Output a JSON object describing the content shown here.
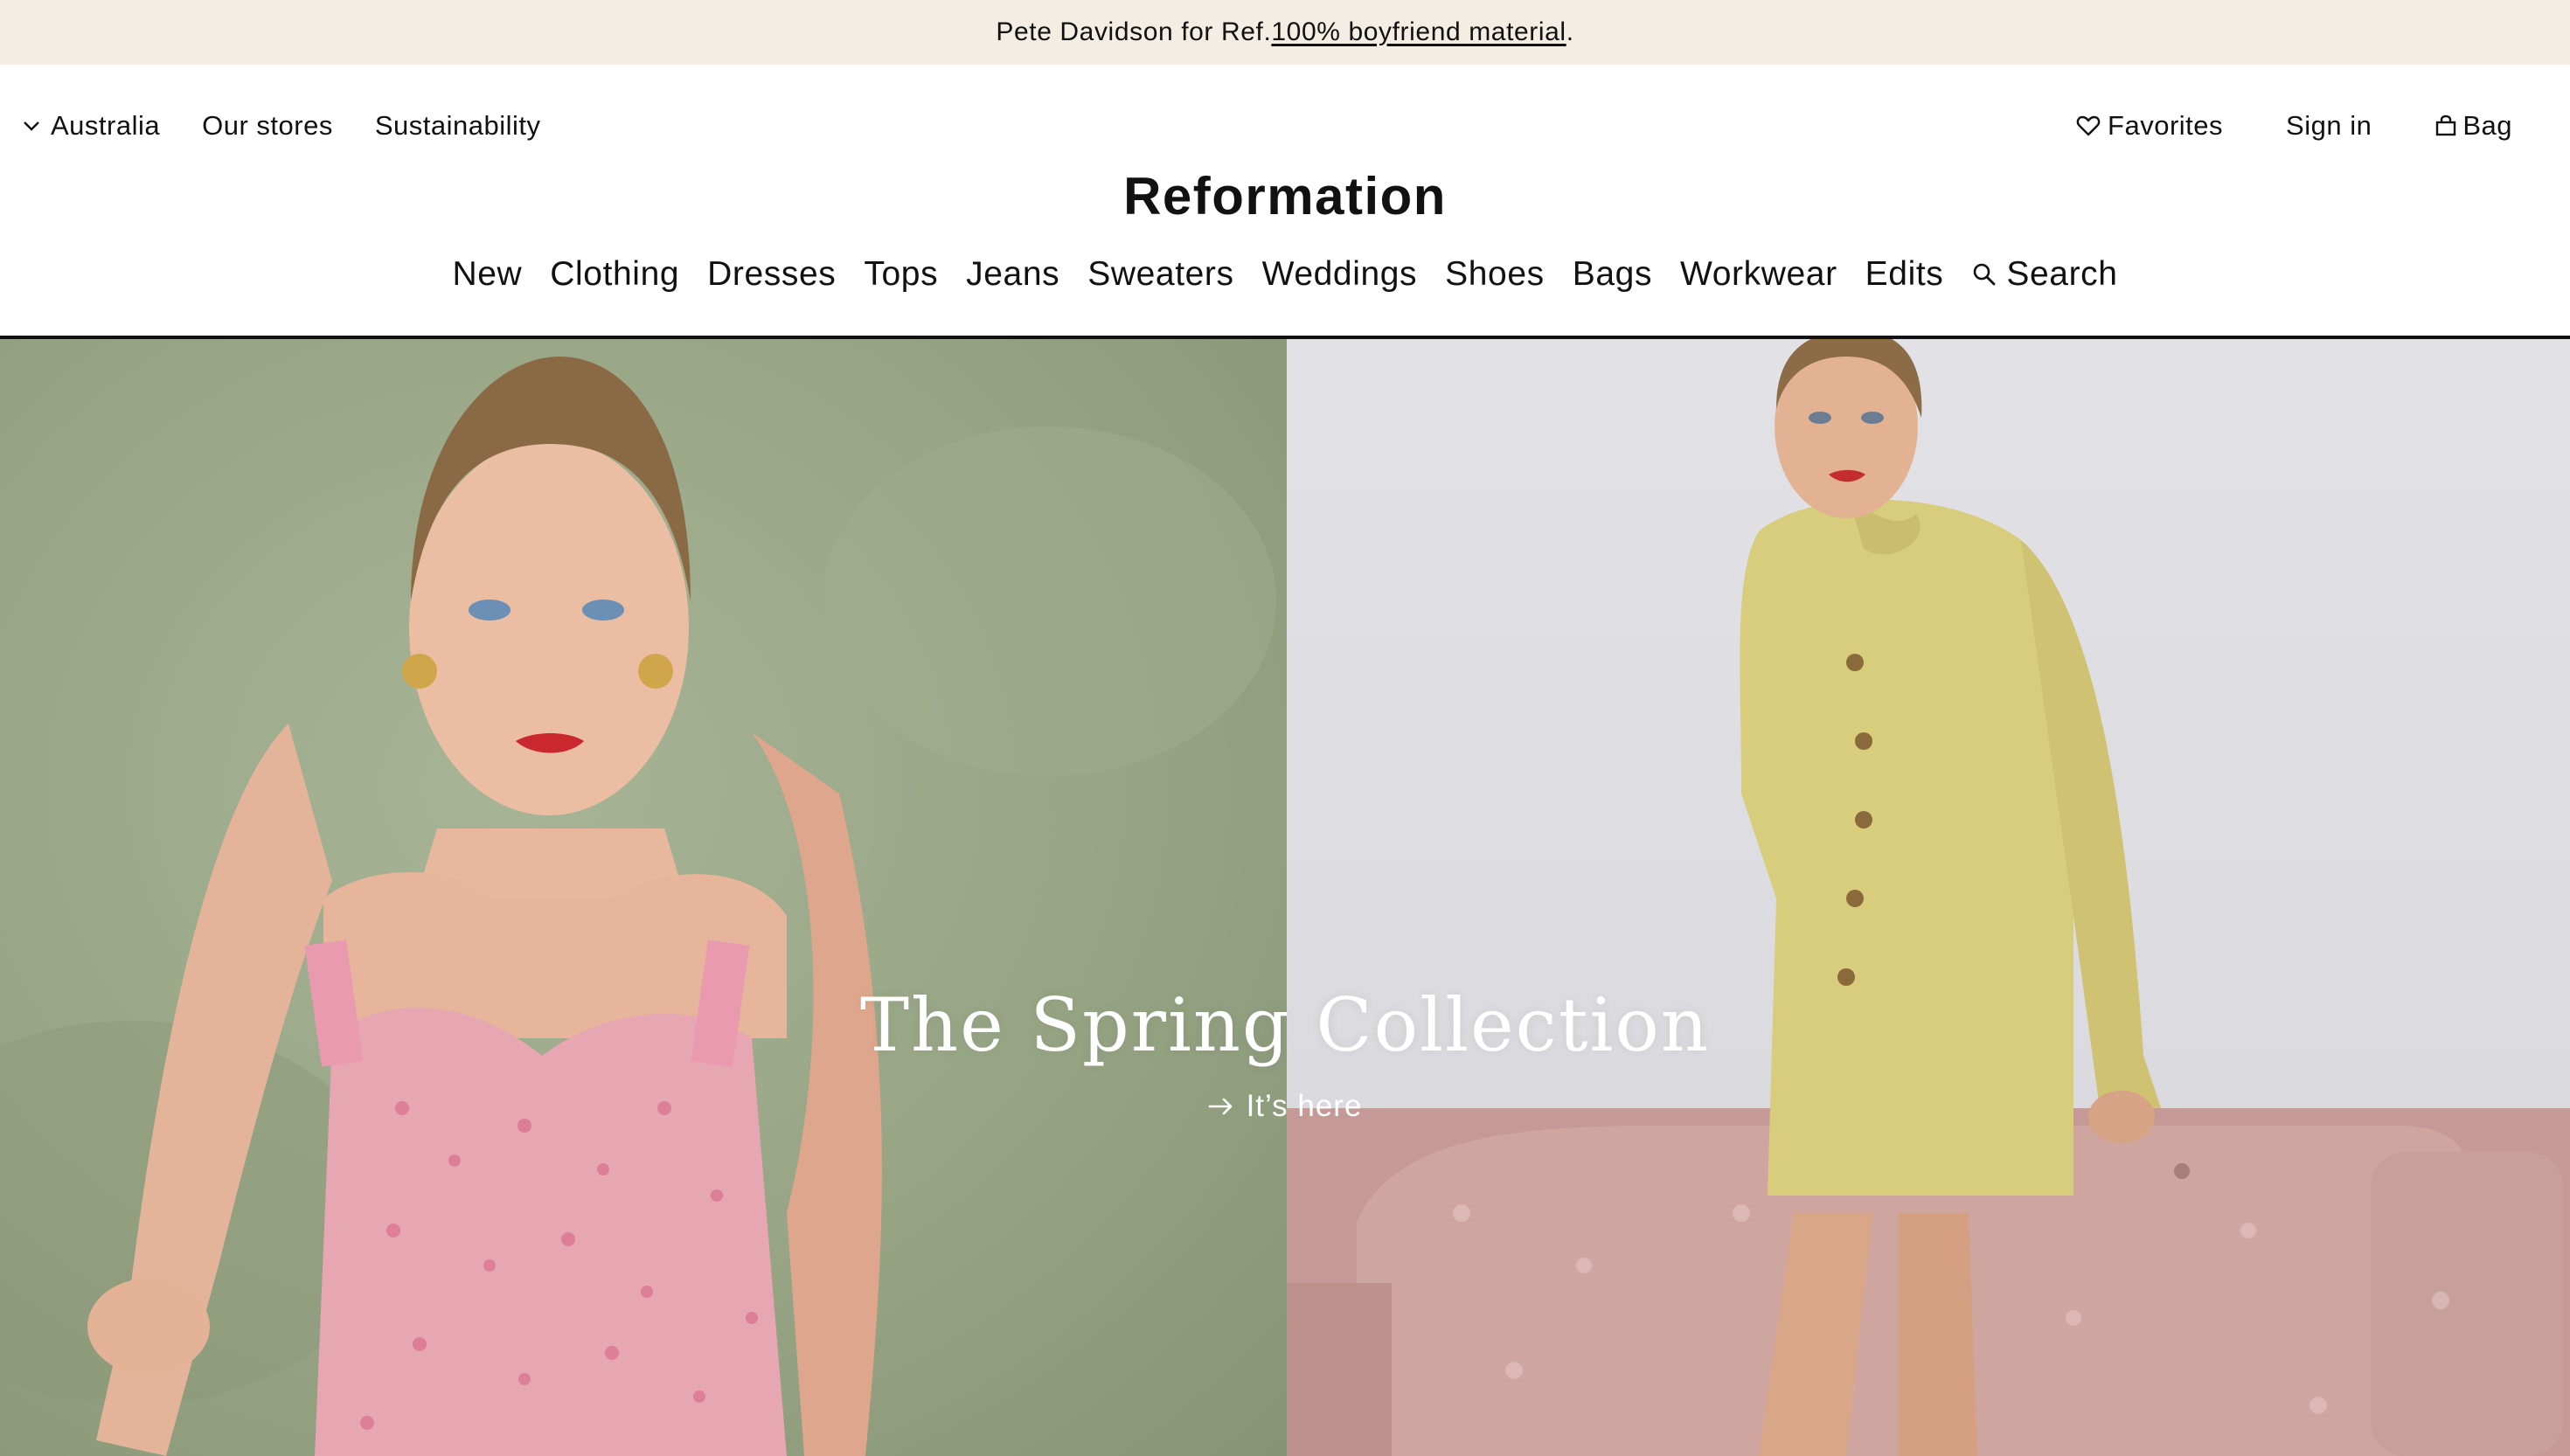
{
  "promo": {
    "text": "Pete Davidson for Ref. ",
    "link": "100% boyfriend material",
    "suffix": "."
  },
  "utility": {
    "left": [
      {
        "label": "Australia",
        "icon": "chevron-down-icon"
      },
      {
        "label": "Our stores"
      },
      {
        "label": "Sustainability"
      }
    ],
    "right": [
      {
        "label": "Favorites",
        "icon": "heart-icon"
      },
      {
        "label": "Sign in"
      },
      {
        "label": "Bag",
        "icon": "bag-icon"
      }
    ]
  },
  "brand": "Reformation",
  "nav": {
    "items": [
      "New",
      "Clothing",
      "Dresses",
      "Tops",
      "Jeans",
      "Sweaters",
      "Weddings",
      "Shoes",
      "Bags",
      "Workwear",
      "Edits"
    ],
    "search_label": "Search",
    "search_icon": "search-icon"
  },
  "hero": {
    "title": "The Spring Collection",
    "cta": "It’s here",
    "cta_icon": "arrow-right-icon",
    "images": [
      "model in pink floral dress on green carpet",
      "model in yellow leather coat beside pink sofa"
    ]
  },
  "colors": {
    "promo_bg": "#f3ede3",
    "text": "#111111",
    "hero_text": "#ffffff"
  }
}
